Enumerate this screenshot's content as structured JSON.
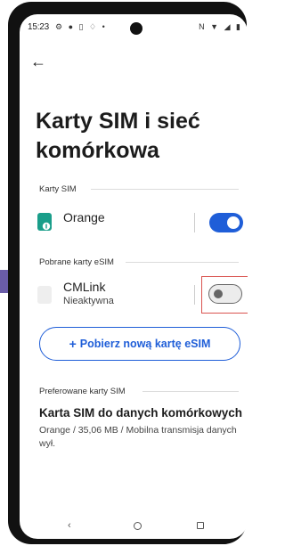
{
  "status_bar": {
    "time": "15:23",
    "left_icons": [
      "settings-icon",
      "messenger-icon",
      "phone-storage-icon",
      "location-icon",
      "dot-icon"
    ],
    "right_icons": [
      "nfc-icon",
      "wifi-icon",
      "signal-icon",
      "battery-icon"
    ]
  },
  "page": {
    "title": "Karty SIM i sieć komórkowa"
  },
  "sections": {
    "sim": {
      "header": "Karty SIM",
      "item": {
        "name": "Orange",
        "enabled": true
      }
    },
    "esim": {
      "header": "Pobrane karty eSIM",
      "item": {
        "name": "CMLink",
        "status": "Nieaktywna",
        "enabled": false
      }
    },
    "download_button": {
      "plus": "+",
      "label": "Pobierz nową kartę eSIM"
    },
    "preferred": {
      "header": "Preferowane karty SIM",
      "title": "Karta SIM do danych komórkowych",
      "description": "Orange / 35,06 MB / Mobilna transmisja danych wył."
    }
  },
  "colors": {
    "accent": "#1f5ed8",
    "orange_sim_icon": "#1a9e8a",
    "highlight": "#d9534f"
  }
}
